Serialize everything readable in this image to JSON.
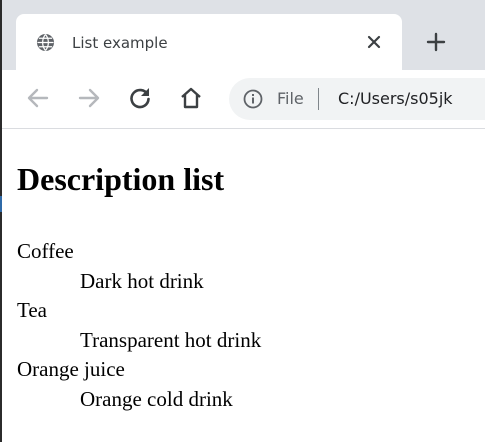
{
  "browser": {
    "tab": {
      "title": "List example"
    },
    "address_bar": {
      "scheme_label": "File",
      "url": "C:/Users/s05jk"
    }
  },
  "page": {
    "heading": "Description list",
    "list": [
      {
        "term": "Coffee",
        "description": "Dark hot drink"
      },
      {
        "term": "Tea",
        "description": "Transparent hot drink"
      },
      {
        "term": "Orange juice",
        "description": "Orange cold drink"
      }
    ]
  },
  "icons": {
    "favicon": "globe-icon",
    "close": "close-icon",
    "new_tab": "plus-icon",
    "back": "back-arrow-icon",
    "forward": "forward-arrow-icon",
    "reload": "reload-icon",
    "home": "home-icon",
    "info": "info-icon"
  },
  "colors": {
    "tabstrip_bg": "#dee1e6",
    "omnibox_bg": "#f1f3f4",
    "icon_enabled": "#3c4043",
    "icon_disabled": "#b5b8bc"
  }
}
